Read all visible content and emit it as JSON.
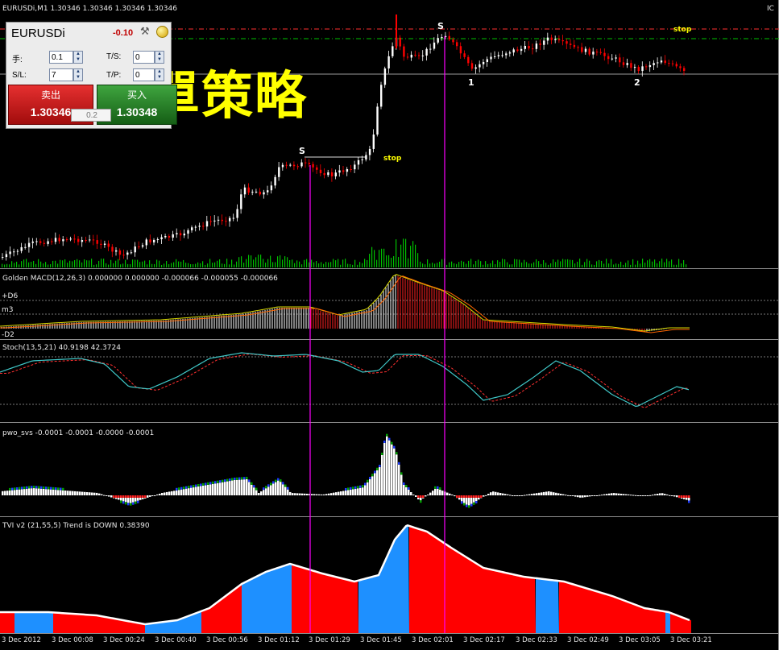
{
  "window": {
    "title": "EURUSDi,M1  1.30346 1.30346 1.30346 1.30346",
    "corner_label": "IC"
  },
  "trade_panel": {
    "symbol": "EURUSDi",
    "change": "-0.10",
    "lots_label": "手:",
    "lots_value": "0.1",
    "ts_label": "T/S:",
    "ts_value": "0",
    "sl_label": "S/L:",
    "sl_value": "7",
    "tp_label": "T/P:",
    "tp_value": "0",
    "sell_label": "卖出",
    "sell_price": "1.30346",
    "buy_label": "买入",
    "buy_price": "1.30348",
    "mid_lots": "0.2"
  },
  "overlay_text": "空單策略",
  "annotations": {
    "stop1": "stop",
    "stop2": "stop",
    "s1": "S",
    "s2": "S",
    "p1": "1",
    "p2": "2"
  },
  "indicators": {
    "macd": "Golden MACD(12,26,3) 0.000000 0.000000 -0.000066 -0.000055 -0.000066",
    "macd_levels": [
      "+D6",
      "m3",
      "-D2"
    ],
    "stoch": "Stoch(13,5,21) 40.9198 42.3724",
    "pwo": "pwo_svs -0.0001 -0.0001 -0.0000 -0.0001",
    "tvi": "TVI v2 (21,55,5) Trend is DOWN 0.38390"
  },
  "time_axis": [
    "3 Dec 2012",
    "3 Dec 00:08",
    "3 Dec 00:24",
    "3 Dec 00:40",
    "3 Dec 00:56",
    "3 Dec 01:12",
    "3 Dec 01:29",
    "3 Dec 01:45",
    "3 Dec 02:01",
    "3 Dec 02:17",
    "3 Dec 02:33",
    "3 Dec 02:49",
    "3 Dec 03:05",
    "3 Dec 03:21"
  ],
  "colors": {
    "up": "#ffffff",
    "down": "#ff0000",
    "volume": "#00c000",
    "tvi_up": "#1e90ff",
    "tvi_down": "#ff0000",
    "signal": "#ff00ff",
    "stop": "#ffff00"
  }
}
